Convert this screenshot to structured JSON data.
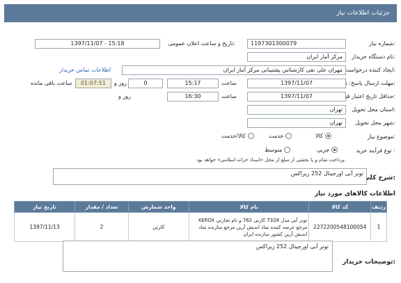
{
  "page": {
    "title": "جزئیات اطلاعات نیاز"
  },
  "form": {
    "need_number": {
      "label": "شماره نیاز:",
      "value": "1197301300079"
    },
    "announce_date": {
      "label": "تاریخ و ساعت اعلان عمومی:",
      "value": "1397/11/07 - 15:18"
    },
    "buyer_org": {
      "label": "نام دستگاه خریدار:",
      "value": "مرکز آمار ایران"
    },
    "requester": {
      "label": "ایجاد کننده درخواست:",
      "value": "مهران  علی نقی کارشناس پشتیبانی مرکز آمار ایران"
    },
    "contact_link": "اطلاعات تماس خریدار",
    "reply_deadline": {
      "label": "مهلت ارسال پاسخ: تا تاریخ:",
      "date": "1397/11/07",
      "time_label": "ساعت",
      "time": "15:17",
      "days": "0",
      "days_label": "روز و",
      "remain": "01:07:51",
      "remain_label": "ساعت باقی مانده"
    },
    "validity": {
      "label": "حداقل تاریخ اعتبار قیمت: تا تاریخ:",
      "date": "1397/11/07",
      "time_label": "ساعت",
      "time": "16:30"
    },
    "delivery_province": {
      "label": "استان محل تحویل:",
      "value": "تهران"
    },
    "delivery_city": {
      "label": "شهر محل تحویل:",
      "value": "تهران"
    },
    "category": {
      "label": "موضوع نیاز:",
      "options": [
        "کالا",
        "خدمت",
        "کالا/خدمت"
      ],
      "selected": "کالا"
    },
    "purchase_process": {
      "label": "نوع فرآیند خرید :",
      "options": [
        "جزیی",
        "متوسط"
      ],
      "selected": "جزیی"
    },
    "purchase_note": "پرداخت تمام و یا بخشی از مبلغ از محل «اسناد خزانه اسلامی» خواهد بود."
  },
  "need_summary": {
    "label": "شرح کلی نیاز:",
    "value": "تونر آبی اورجینال 252 زیراکس"
  },
  "goods": {
    "title": "اطلاعات کالاهای مورد نیاز",
    "headers": [
      "ردیف",
      "کد کالا",
      "نام کالا",
      "واحد شمارش",
      "تعداد / مقدار",
      "تاریخ نیاز"
    ],
    "rows": [
      {
        "row": "1",
        "code": "2272200548100054",
        "name": "تونر آبی مدل 7328 کارتی 762 و نام تجارتی XEROX مرجع عرضه کننده نماد اندیش آرین مرجع سازنده نماد اندیش آرین کشور سازنده ایران",
        "unit": "کارتن",
        "qty": "2",
        "date": "1397/11/13"
      }
    ]
  },
  "buyer_notes": {
    "label": "توضیحات خریدار:",
    "value": "تونر آبی اورجینال 252 زیراکس"
  }
}
